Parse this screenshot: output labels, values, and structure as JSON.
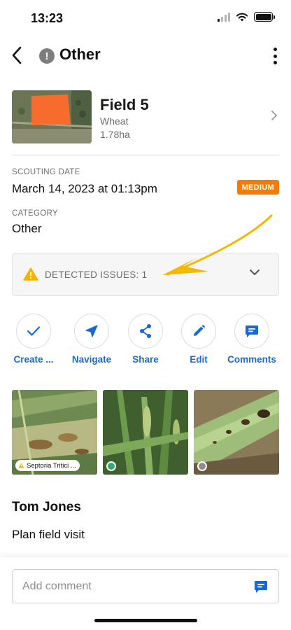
{
  "status_bar": {
    "time": "13:23"
  },
  "header": {
    "title": "Other",
    "title_icon": "!"
  },
  "field": {
    "name": "Field 5",
    "crop": "Wheat",
    "area": "1.78ha"
  },
  "scouting": {
    "date_label": "SCOUTING DATE",
    "date_value": "March 14, 2023 at 01:13pm",
    "severity": "MEDIUM",
    "severity_color": "#f57c00"
  },
  "category": {
    "label": "CATEGORY",
    "value": "Other"
  },
  "issues": {
    "label": "DETECTED ISSUES: 1"
  },
  "actions": [
    {
      "label": "Create ...",
      "icon": "check-icon"
    },
    {
      "label": "Navigate",
      "icon": "navigate-arrow-icon"
    },
    {
      "label": "Share",
      "icon": "share-icon"
    },
    {
      "label": "Edit",
      "icon": "pencil-icon"
    },
    {
      "label": "Comments",
      "icon": "comment-icon"
    }
  ],
  "photos": [
    {
      "tag": "Septoria Tritici ..."
    },
    {
      "status_color": "#2eaa6e"
    },
    {
      "status_color": "#8e8e8e"
    }
  ],
  "note": {
    "author": "Tom Jones",
    "text": "Plan field visit"
  },
  "comment": {
    "placeholder": "Add comment"
  },
  "colors": {
    "accent": "#1769d6",
    "annotation_arrow": "#f5b800",
    "warning": "#f5b400"
  }
}
